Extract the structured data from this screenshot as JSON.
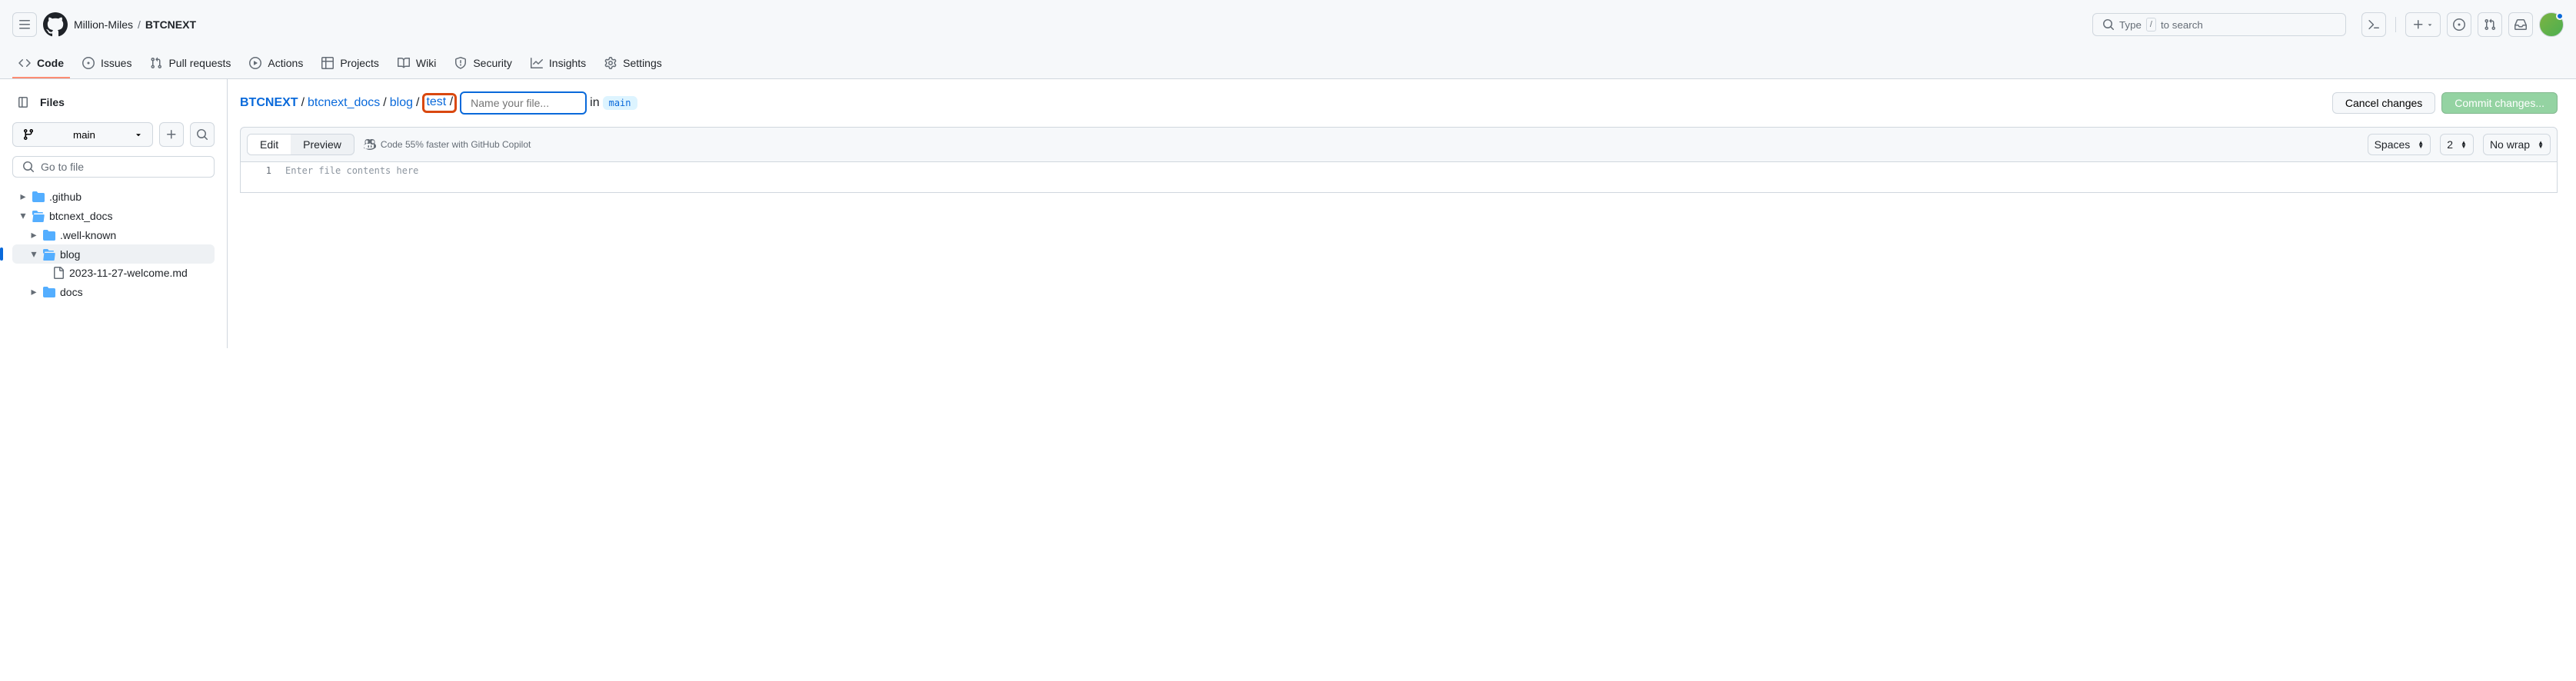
{
  "header": {
    "owner": "Million-Miles",
    "repo": "BTCNEXT",
    "search_prefix": "Type",
    "search_key": "/",
    "search_suffix": "to search"
  },
  "nav": {
    "code": "Code",
    "issues": "Issues",
    "pulls": "Pull requests",
    "actions": "Actions",
    "projects": "Projects",
    "wiki": "Wiki",
    "security": "Security",
    "insights": "Insights",
    "settings": "Settings"
  },
  "sidebar": {
    "title": "Files",
    "branch": "main",
    "file_search_placeholder": "Go to file",
    "tree": {
      "github": ".github",
      "btcnext_docs": "btcnext_docs",
      "well_known": ".well-known",
      "blog": "blog",
      "blog_file": "2023-11-27-welcome.md",
      "docs": "docs"
    }
  },
  "path": {
    "root": "BTCNEXT",
    "seg1": "btcnext_docs",
    "seg2": "blog",
    "seg3": "test",
    "filename_placeholder": "Name your file...",
    "in": "in",
    "branch": "main"
  },
  "actions": {
    "cancel": "Cancel changes",
    "commit": "Commit changes..."
  },
  "toolbar": {
    "edit": "Edit",
    "preview": "Preview",
    "copilot": "Code 55% faster with GitHub Copilot",
    "indent_mode": "Spaces",
    "indent_size": "2",
    "wrap": "No wrap"
  },
  "editor": {
    "line1": "1",
    "placeholder": "Enter file contents here"
  }
}
